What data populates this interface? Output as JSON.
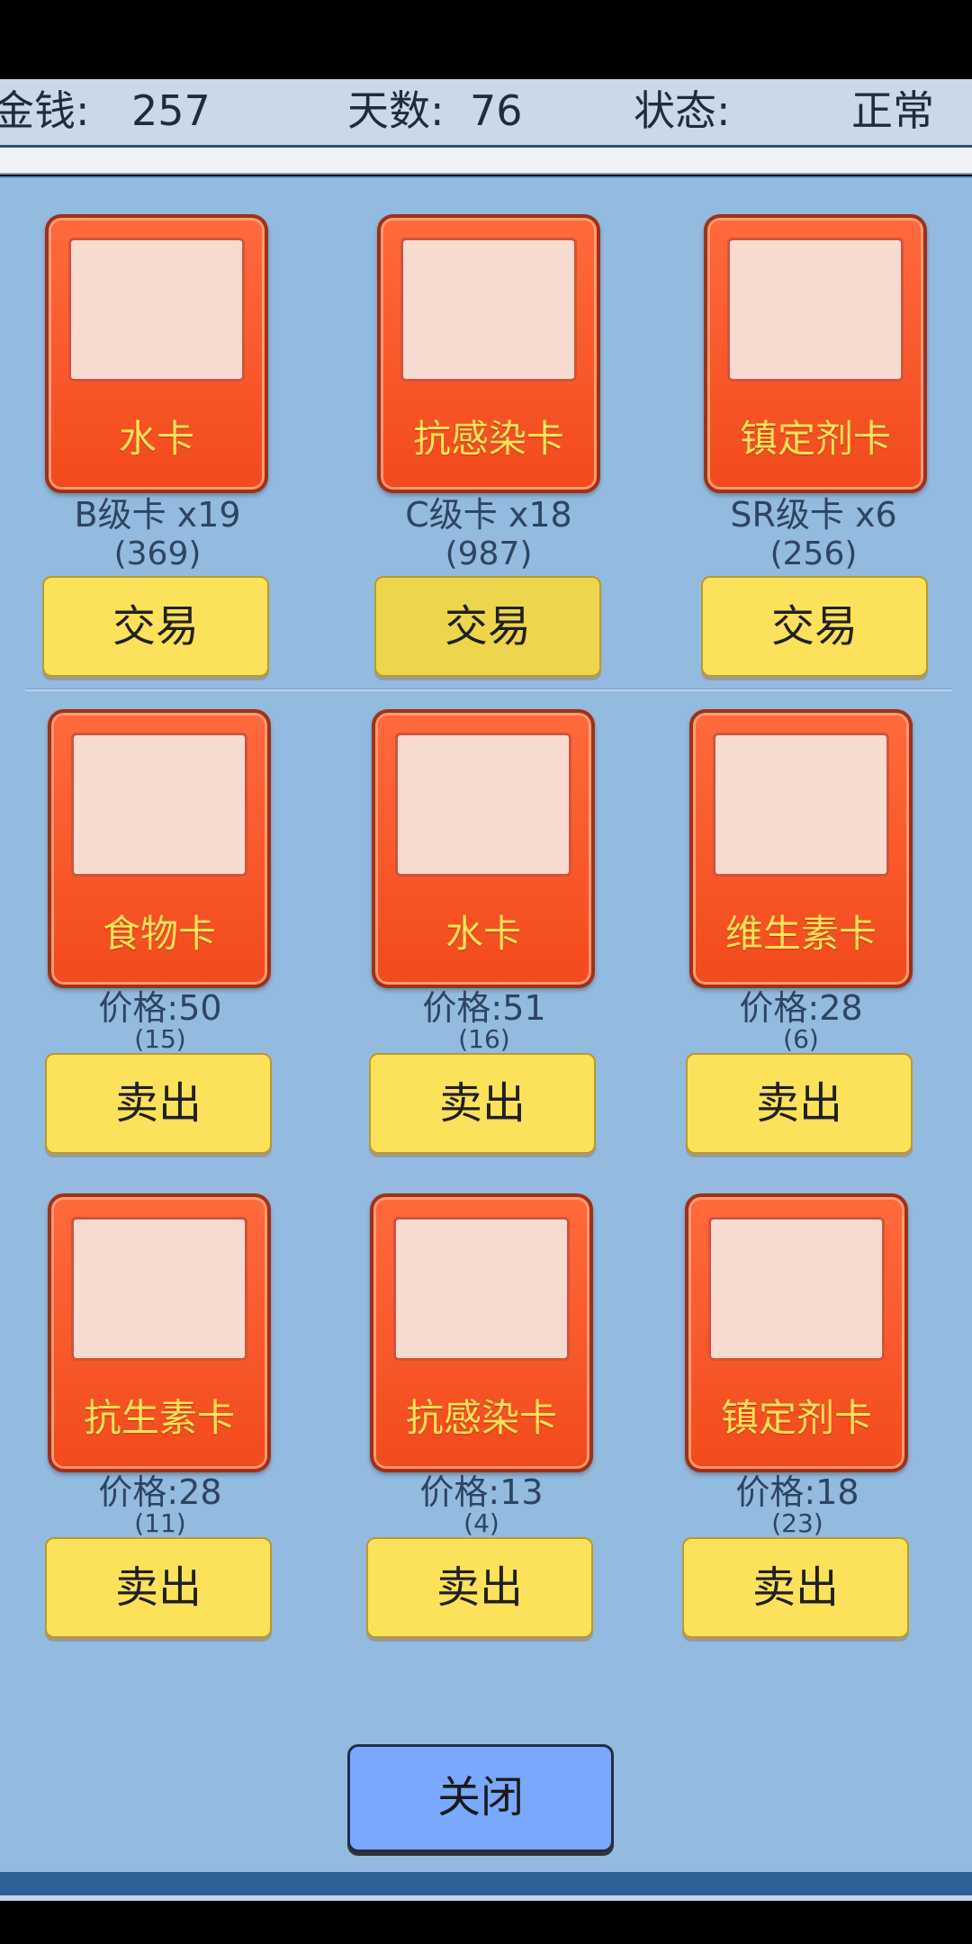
{
  "status": {
    "money_label": "金钱:",
    "money_value": "257",
    "days_label": "天数:",
    "days_value": "76",
    "state_label": "状态:",
    "state_value": "正常"
  },
  "trade_cards": [
    {
      "name": "水卡",
      "grade": "B级卡 x19",
      "value": "(369)",
      "button": "交易"
    },
    {
      "name": "抗感染卡",
      "grade": "C级卡 x18",
      "value": "(987)",
      "button": "交易"
    },
    {
      "name": "镇定剂卡",
      "grade": "SR级卡 x6",
      "value": "(256)",
      "button": "交易"
    }
  ],
  "sell_cards": [
    {
      "name": "食物卡",
      "price": "价格:50",
      "count": "(15)",
      "button": "卖出"
    },
    {
      "name": "水卡",
      "price": "价格:51",
      "count": "(16)",
      "button": "卖出"
    },
    {
      "name": "维生素卡",
      "price": "价格:28",
      "count": "(6)",
      "button": "卖出"
    },
    {
      "name": "抗生素卡",
      "price": "价格:28",
      "count": "(11)",
      "button": "卖出"
    },
    {
      "name": "抗感染卡",
      "price": "价格:13",
      "count": "(4)",
      "button": "卖出"
    },
    {
      "name": "镇定剂卡",
      "price": "价格:18",
      "count": "(23)",
      "button": "卖出"
    }
  ],
  "close_label": "关闭"
}
